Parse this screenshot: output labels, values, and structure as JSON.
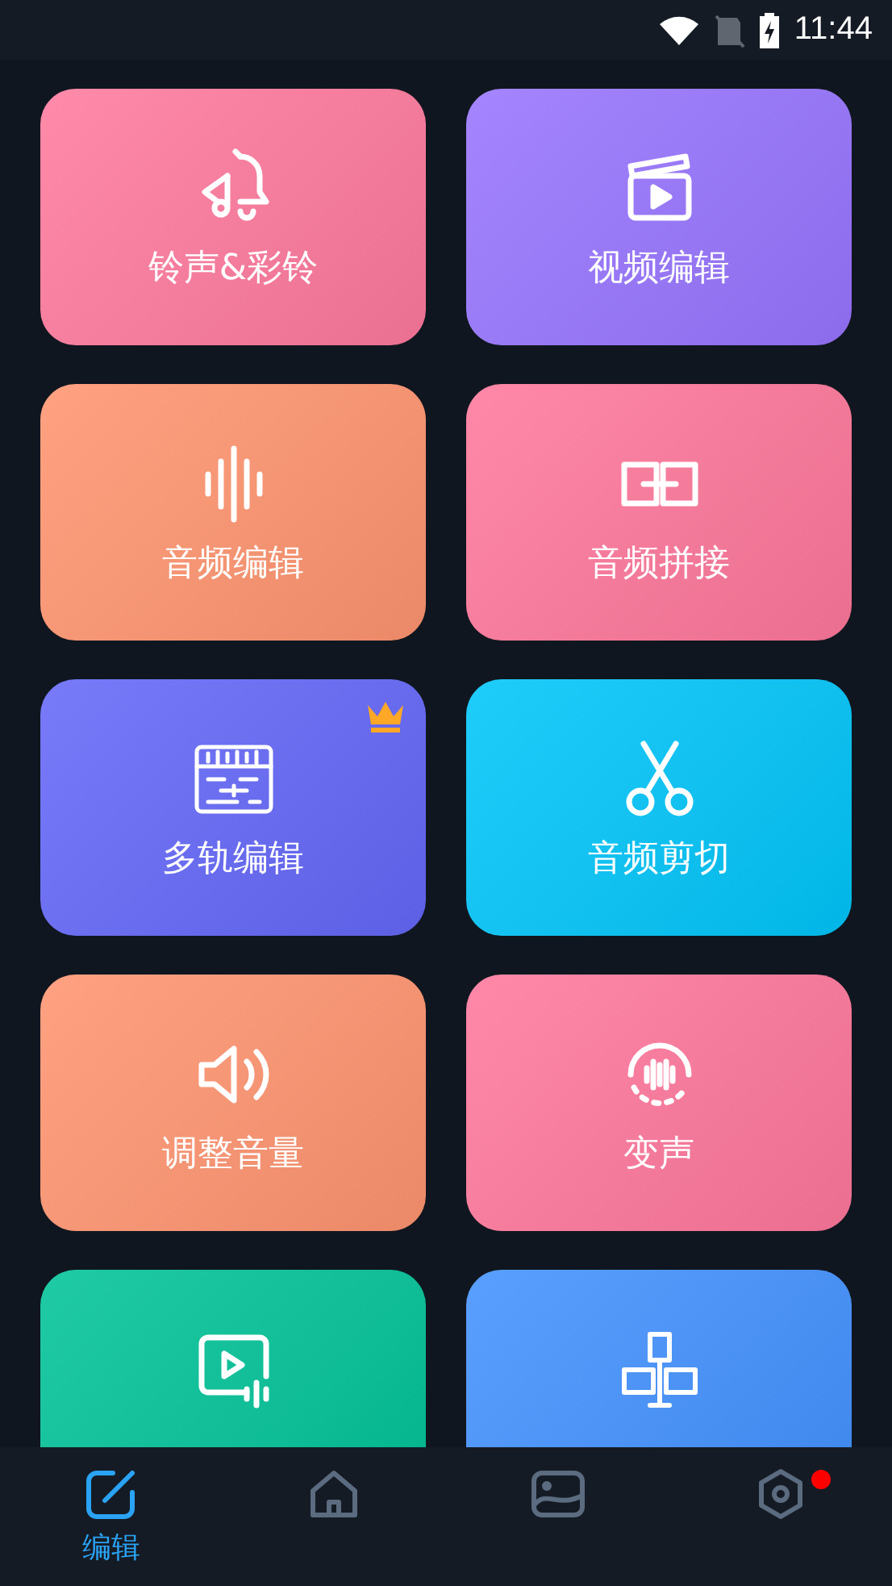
{
  "status_bar": {
    "time": "11:44"
  },
  "tiles": [
    {
      "kind": "ringtone",
      "label": "铃声&彩铃",
      "color": "#ff7a9e",
      "premium": false
    },
    {
      "kind": "video",
      "label": "视频编辑",
      "color": "#9875ff",
      "premium": false
    },
    {
      "kind": "wave",
      "label": "音频编辑",
      "color": "#ff9570",
      "premium": false
    },
    {
      "kind": "join",
      "label": "音频拼接",
      "color": "#ff789c",
      "premium": false
    },
    {
      "kind": "tracks",
      "label": "多轨编辑",
      "color": "#6568f8",
      "premium": true
    },
    {
      "kind": "scissors",
      "label": "音频剪切",
      "color": "#00c6fa",
      "premium": false
    },
    {
      "kind": "volume",
      "label": "调整音量",
      "color": "#ff9571",
      "premium": false
    },
    {
      "kind": "voice",
      "label": "变声",
      "color": "#ff789d",
      "premium": false
    },
    {
      "kind": "video-audio",
      "color": "#00c398",
      "premium": false
    },
    {
      "kind": "insert",
      "color": "#4392ff",
      "premium": false
    }
  ],
  "nav": [
    {
      "kind": "edit",
      "label": "编辑",
      "selected": true,
      "badge": false
    },
    {
      "kind": "home",
      "selected": false,
      "badge": false
    },
    {
      "kind": "gallery",
      "selected": false,
      "badge": false
    },
    {
      "kind": "settings",
      "selected": false,
      "badge": true
    }
  ]
}
